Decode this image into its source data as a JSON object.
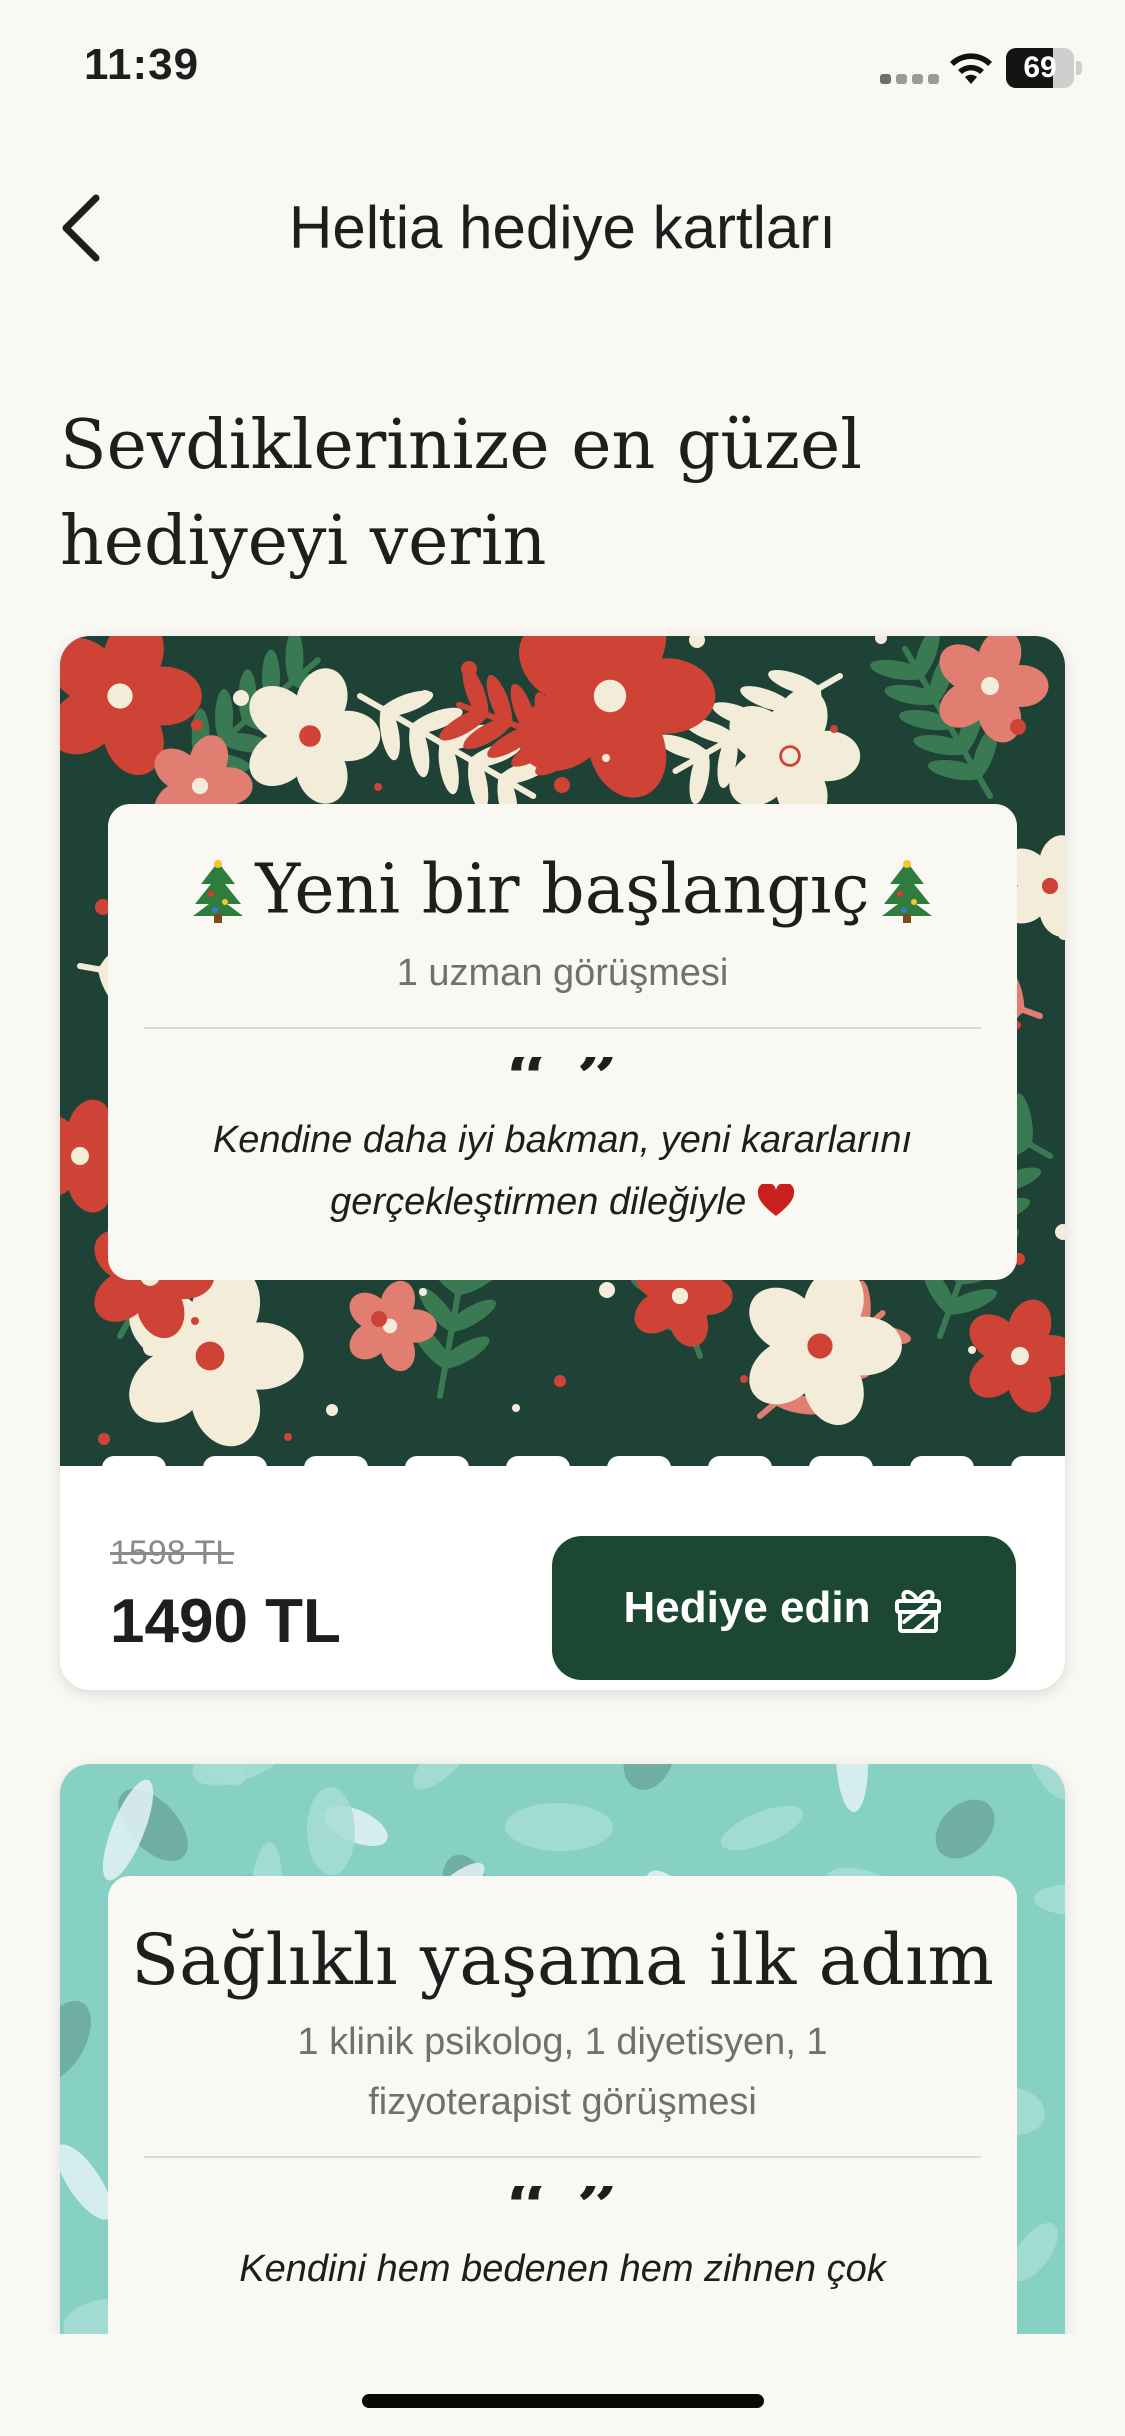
{
  "status_bar": {
    "time": "11:39",
    "battery": "69",
    "battery_level": 0.69
  },
  "header": {
    "title": "Heltia hediye kartları"
  },
  "heading": {
    "line1": "Sevdiklerinize en güzel",
    "line2": "hediyeyi verin"
  },
  "cards": [
    {
      "title": "Yeni bir başlangıç",
      "subtitle": "1 uzman görüşmesi",
      "quote_line1": "Kendine daha iyi bakman, yeni kararlarını",
      "quote_line2": "gerçekleştirmen dileğiyle",
      "old_price": "1598 TL",
      "price": "1490 TL",
      "button_label": "Hediye edin",
      "theme": {
        "background": "#1f4236",
        "accent_red": "#cf4336",
        "accent_pink": "#e27d72",
        "accent_green": "#3a7a52",
        "accent_cream": "#f2ecd9"
      }
    },
    {
      "title": "Sağlıklı yaşama ilk adım",
      "subtitle_line1": "1 klinik psikolog, 1 diyetisyen, 1",
      "subtitle_line2": "fizyoterapist görüşmesi",
      "quote_line1": "Kendini hem bedenen hem zihnen çok",
      "theme": {
        "background": "#86d0c4",
        "accent_light": "#e4f2f6",
        "accent_grey": "#6ca89c"
      }
    }
  ],
  "icons": [
    "back-chevron-icon",
    "christmas-tree-icon",
    "quote-icon",
    "heart-icon",
    "gift-icon",
    "wifi-icon",
    "battery-icon",
    "cellular-signal-icon"
  ],
  "colors": {
    "background": "#faf8f3",
    "button": "#1c4733",
    "text": "#1e1e1e",
    "muted": "#707070"
  }
}
